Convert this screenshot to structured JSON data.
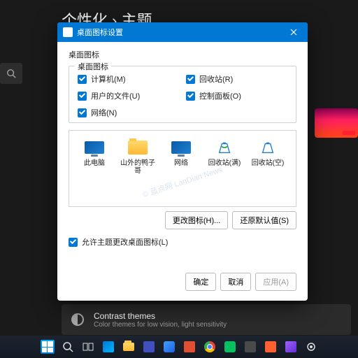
{
  "breadcrumb": "个性化 › 主题",
  "contrast": {
    "title": "Contrast themes",
    "sub": "Color themes for low vision, light sensitivity"
  },
  "dialog": {
    "title": "桌面图标设置",
    "tab": "桌面图标",
    "legend": "桌面图标",
    "checks": [
      {
        "label": "计算机(M)",
        "checked": true
      },
      {
        "label": "回收站(R)",
        "checked": true
      },
      {
        "label": "用户的文件(U)",
        "checked": true
      },
      {
        "label": "控制面板(O)",
        "checked": true
      },
      {
        "label": "网络(N)",
        "checked": true
      }
    ],
    "icons": [
      {
        "label": "此电脑",
        "kind": "monitor"
      },
      {
        "label": "山外的鸭子哥",
        "kind": "folder"
      },
      {
        "label": "网络",
        "kind": "monitor"
      },
      {
        "label": "回收站(满)",
        "kind": "recycle"
      },
      {
        "label": "回收站(空)",
        "kind": "recycle"
      }
    ],
    "change_btn": "更改图标(H)...",
    "restore_btn": "还原默认值(S)",
    "allow_label": "允许主题更改桌面图标(L)",
    "allow_checked": true,
    "ok": "确定",
    "cancel": "取消",
    "apply": "应用(A)"
  },
  "watermark": "© 蓝点网 LanDian News"
}
